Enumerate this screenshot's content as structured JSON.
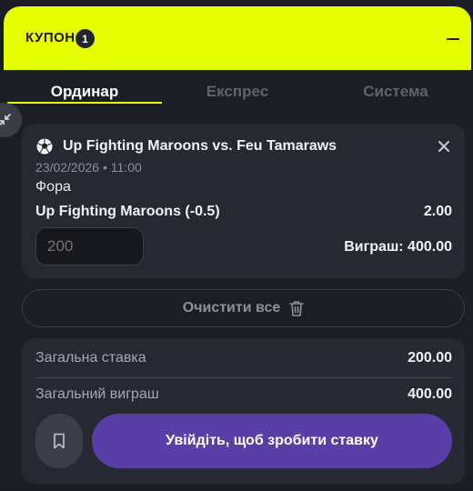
{
  "header": {
    "title": "КУПОН",
    "count": "1",
    "collapse_icon": "minus-icon",
    "background_color": "#e6ff00"
  },
  "tabs": [
    {
      "label": "Ординар",
      "active": true
    },
    {
      "label": "Експрес",
      "active": false
    },
    {
      "label": "Система",
      "active": false
    }
  ],
  "side_handle_icon": "collapse-arrows-icon",
  "bet": {
    "sport_icon": "soccer-ball-icon",
    "event": "Up Fighting Maroons vs. Feu Tamaraws",
    "date": "23/02/2026",
    "time": "11:00",
    "market": "Фора",
    "selection": "Up Fighting Maroons (-0.5)",
    "odds": "2.00",
    "stake_placeholder": "200",
    "win_text": "Виграш: 400.00",
    "close_icon": "close-icon"
  },
  "clear_all": {
    "label": "Очистити все",
    "icon": "trash-icon"
  },
  "summary": {
    "total_stake_label": "Загальна ставка",
    "total_stake_value": "200.00",
    "total_win_label": "Загальний виграш",
    "total_win_value": "400.00",
    "bookmark_icon": "bookmark-icon",
    "place_bet_label": "Увійдіть, щоб зробити ставку",
    "place_bet_color": "#5a3ea8"
  }
}
